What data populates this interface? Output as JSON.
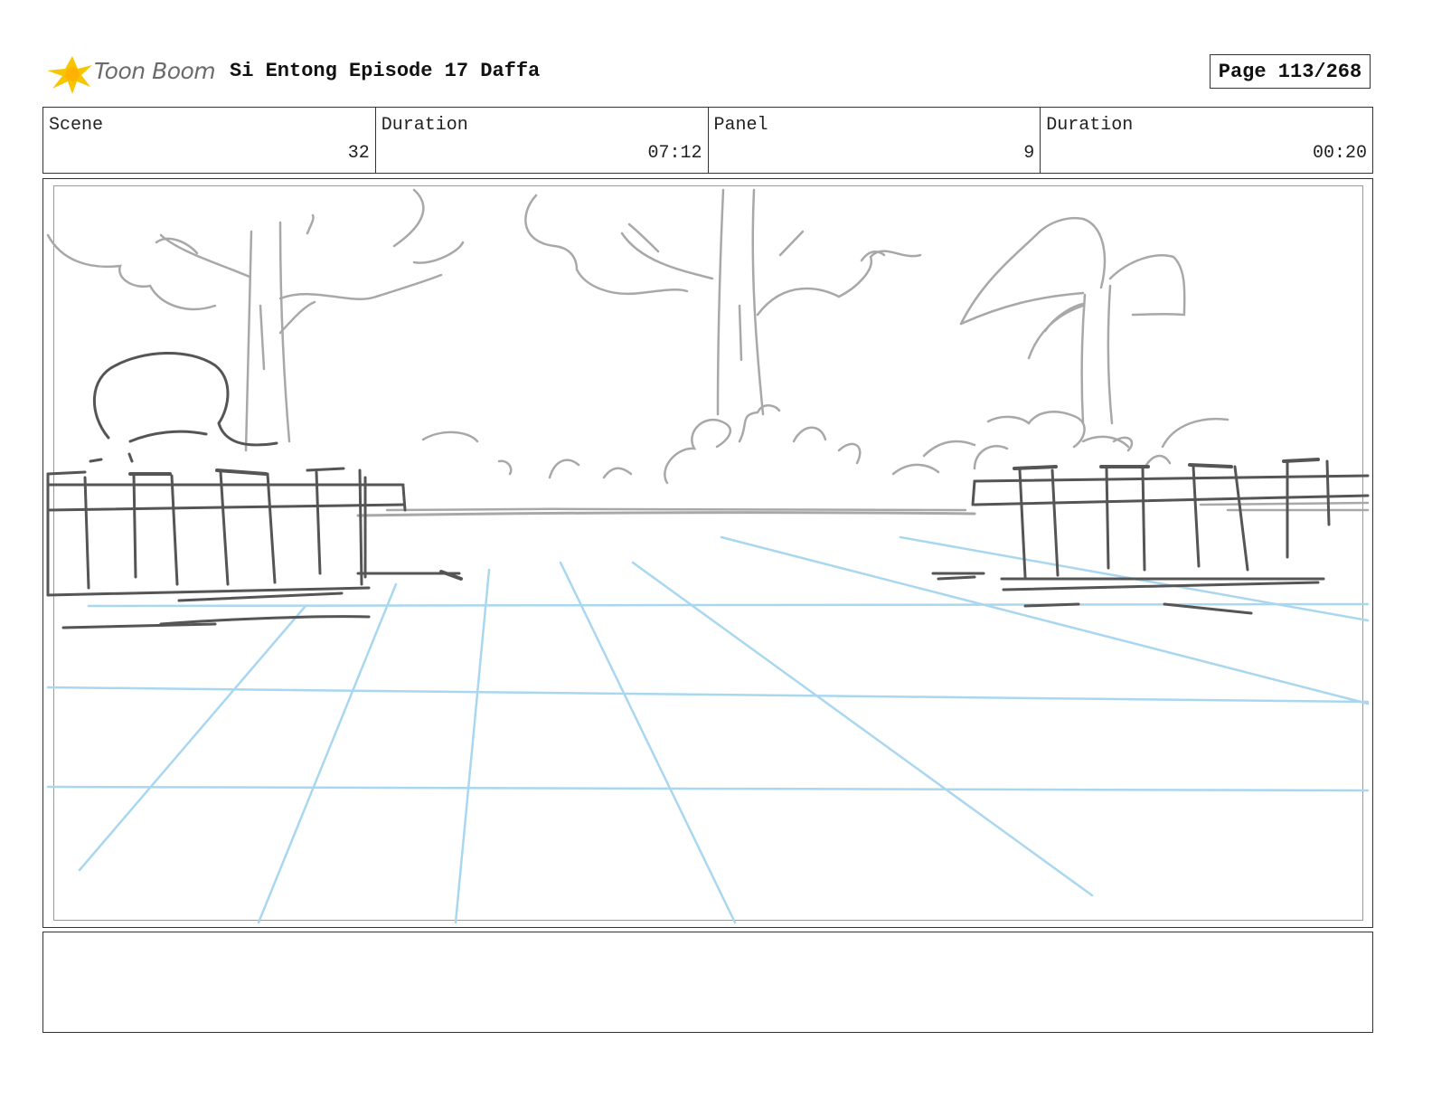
{
  "header": {
    "logo_text": "Toon Boom",
    "title": "Si Entong Episode 17 Daffa",
    "page_label": "Page 113/268"
  },
  "info": {
    "scene_label": "Scene",
    "scene_value": "32",
    "scene_duration_label": "Duration",
    "scene_duration_value": "07:12",
    "panel_label": "Panel",
    "panel_value": "9",
    "panel_duration_label": "Duration",
    "panel_duration_value": "00:20"
  },
  "colors": {
    "sketch_dark": "#555555",
    "sketch_light": "#a8a8a8",
    "guide_blue": "#a9d7f0",
    "logo_yellow": "#f7c600"
  },
  "notes": {
    "text": ""
  }
}
